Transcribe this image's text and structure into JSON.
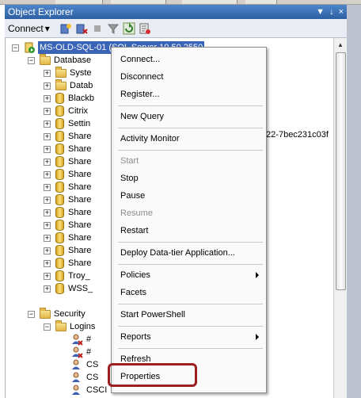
{
  "window": {
    "title": "Object Explorer",
    "pin_glyph": "▼",
    "autohide_glyph": "↓",
    "close_glyph": "×"
  },
  "toolbar": {
    "connect_label": "Connect",
    "connect_arrow": "▾",
    "icons": [
      "connect-server-icon",
      "disconnect-server-icon",
      "stop-icon",
      "filter-icon",
      "refresh-icon",
      "summary-icon"
    ]
  },
  "tree": {
    "server": "MS-OLD-SQL-01 (SQL Server 10.50.2550",
    "databases_label": "Database",
    "database_items": [
      "Syste",
      "Datab",
      "Blackb",
      "Citrix",
      "Settin",
      "Share",
      "Share",
      "Share",
      "Share",
      "Share",
      "Share",
      "Share",
      "Share",
      "Share",
      "Share",
      "Share",
      "Troy_",
      "WSS_"
    ],
    "hidden_tail_text": "f22-7bec231c03f",
    "security_label": "Security",
    "logins_label": "Logins",
    "login_items": [
      "#",
      "#",
      "CS",
      "CS",
      "CSCI"
    ]
  },
  "context_menu": {
    "connect": "Connect...",
    "disconnect": "Disconnect",
    "register": "Register...",
    "new_query": "New Query",
    "activity_monitor": "Activity Monitor",
    "start": "Start",
    "stop": "Stop",
    "pause": "Pause",
    "resume": "Resume",
    "restart": "Restart",
    "deploy": "Deploy Data-tier Application...",
    "policies": "Policies",
    "facets": "Facets",
    "start_powershell": "Start PowerShell",
    "reports": "Reports",
    "refresh": "Refresh",
    "properties": "Properties"
  },
  "colors": {
    "highlight_ring": "#9c1f1f",
    "titlebar": "#2c5fa3",
    "selection": "#3a64b8"
  }
}
